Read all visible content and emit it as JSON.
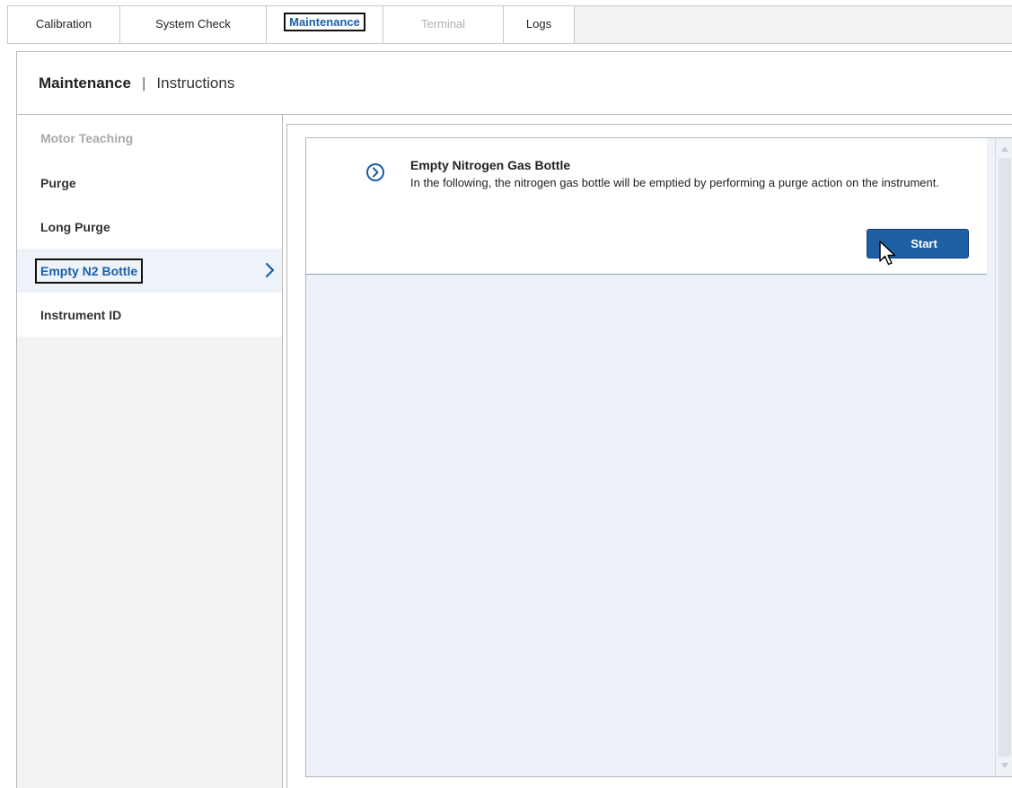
{
  "tabs": [
    {
      "label": "Calibration",
      "state": "normal"
    },
    {
      "label": "System Check",
      "state": "normal"
    },
    {
      "label": "Maintenance",
      "state": "active"
    },
    {
      "label": "Terminal",
      "state": "disabled"
    },
    {
      "label": "Logs",
      "state": "normal"
    }
  ],
  "header": {
    "title": "Maintenance",
    "separator": "|",
    "subtitle": "Instructions"
  },
  "sidebar": {
    "items": [
      {
        "label": "Motor Teaching",
        "state": "disabled"
      },
      {
        "label": "Purge",
        "state": "normal"
      },
      {
        "label": "Long Purge",
        "state": "normal"
      },
      {
        "label": "Empty N2 Bottle",
        "state": "selected"
      },
      {
        "label": "Instrument ID",
        "state": "normal"
      }
    ],
    "selected_icon": "chevron-right-icon"
  },
  "instruction": {
    "icon": "chevron-circle-right-icon",
    "title": "Empty Nitrogen Gas Bottle",
    "description": "In the following, the nitrogen gas bottle will be emptied by performing a purge action on the instrument.",
    "start_label": "Start"
  },
  "colors": {
    "accent": "#1a5fa8",
    "button": "#1f5fa6",
    "panel_bg": "#edf2f8",
    "sidebar_bg": "#f3f3f3",
    "disabled": "#a8a8a8"
  }
}
